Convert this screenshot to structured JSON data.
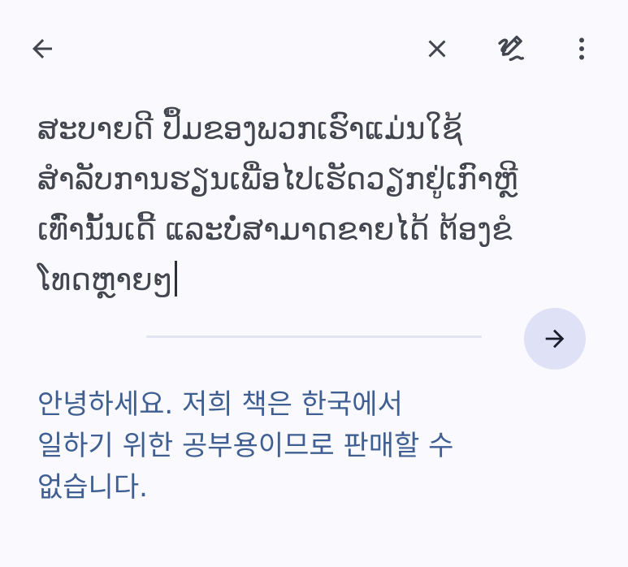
{
  "toolbar": {
    "back_icon": "arrow-back-icon",
    "clear_icon": "close-icon",
    "handwrite_icon": "handwriting-pen-icon",
    "more_icon": "more-vert-icon"
  },
  "source": {
    "text": "ສະບາຍດີ ປຶ້ມຂອງພວກເຮົາແມ່ນໃຊ້\nສຳລັບການຮຽນເພື່ອໄປເຮັດວຽກຢູ່ເກົາຫຼີ\nເທົ່ານັ້ນເດີ້ ແລະບໍ່ສາມາດຂາຍໄດ້ ຕ້ອງຂໍ\nໂທດຫຼາຍໆ"
  },
  "translate_button": {
    "icon": "arrow-forward-icon"
  },
  "translation": {
    "text": "안녕하세요. 저희 책은 한국에서\n일하기 위한 공부용이므로 판매할 수\n없습니다."
  },
  "colors": {
    "background": "#f9f9fe",
    "icon": "#44464f",
    "translation_text": "#3f5f93",
    "button_bg": "#dfe1f7"
  }
}
